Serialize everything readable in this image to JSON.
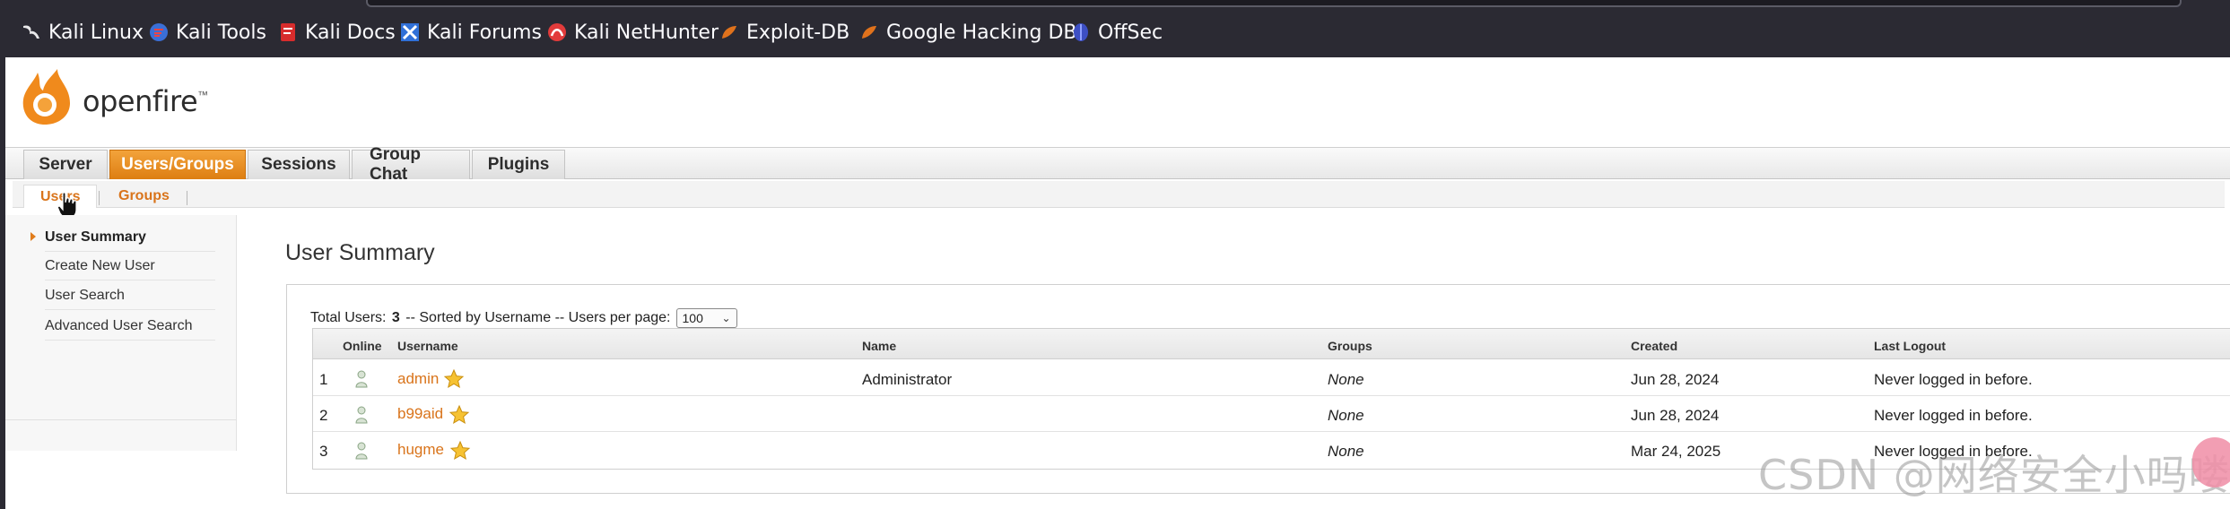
{
  "browser": {
    "bookmarks": [
      {
        "label": "Kali Linux",
        "icon": "kali-dragon-icon"
      },
      {
        "label": "Kali Tools",
        "icon": "kali-tools-icon"
      },
      {
        "label": "Kali Docs",
        "icon": "kali-docs-icon"
      },
      {
        "label": "Kali Forums",
        "icon": "kali-forums-icon"
      },
      {
        "label": "Kali NetHunter",
        "icon": "nethunter-icon"
      },
      {
        "label": "Exploit-DB",
        "icon": "exploit-db-icon"
      },
      {
        "label": "Google Hacking DB",
        "icon": "ghdb-icon"
      },
      {
        "label": "OffSec",
        "icon": "offsec-icon"
      }
    ]
  },
  "app": {
    "logo_text": "openfire",
    "logo_tm": "™",
    "accent_color": "#e0861c",
    "link_color": "#d9741b"
  },
  "tabs": [
    {
      "label": "Server",
      "active": false
    },
    {
      "label": "Users/Groups",
      "active": true
    },
    {
      "label": "Sessions",
      "active": false
    },
    {
      "label": "Group Chat",
      "active": false
    },
    {
      "label": "Plugins",
      "active": false
    }
  ],
  "subtabs": [
    {
      "label": "Users",
      "active": true
    },
    {
      "label": "Groups",
      "active": false
    }
  ],
  "sidebar": {
    "items": [
      {
        "label": "User Summary",
        "active": true
      },
      {
        "label": "Create New User",
        "active": false
      },
      {
        "label": "User Search",
        "active": false
      },
      {
        "label": "Advanced User Search",
        "active": false
      }
    ]
  },
  "main": {
    "title": "User Summary",
    "info_prefix": "Total Users:",
    "total_users": "3",
    "info_suffix": "-- Sorted by Username -- Users per page:",
    "per_page": "100",
    "columns": [
      "Online",
      "Username",
      "Name",
      "Groups",
      "Created",
      "Last Logout"
    ],
    "rows": [
      {
        "index": "1",
        "username": "admin",
        "name": "Administrator",
        "groups": "None",
        "created": "Jun 28, 2024",
        "last_logout": "Never logged in before."
      },
      {
        "index": "2",
        "username": "b99aid",
        "name": "",
        "groups": "None",
        "created": "Jun 28, 2024",
        "last_logout": "Never logged in before."
      },
      {
        "index": "3",
        "username": "hugme",
        "name": "",
        "groups": "None",
        "created": "Mar 24, 2025",
        "last_logout": "Never logged in before."
      }
    ]
  },
  "watermark": "CSDN @网络安全小吗喽"
}
